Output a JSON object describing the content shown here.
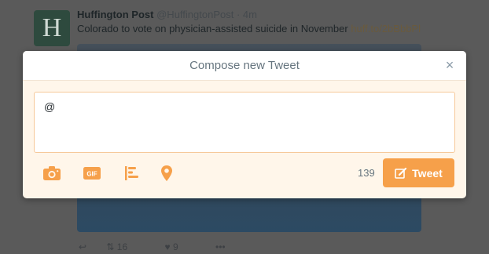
{
  "background_tweet": {
    "avatar_letter": "H",
    "author_name": "Huffington Post",
    "author_handle": "@HuffingtonPost",
    "time": "· 4m",
    "text": "Colorado to vote on physician-assisted suicide in November",
    "link": "huff.to/2bBbbPl",
    "actions": {
      "reply": "",
      "retweet_count": "16",
      "like_count": "9",
      "more": "•••"
    }
  },
  "modal": {
    "title": "Compose new Tweet",
    "close_icon": "close-icon",
    "tweet_text": "@",
    "char_count": "139",
    "tweet_button_label": "Tweet",
    "toolbar": [
      "camera-icon",
      "gif-icon",
      "poll-icon",
      "location-icon"
    ]
  },
  "colors": {
    "accent": "#f6a04a",
    "modal_bg": "#fff6ea",
    "input_border": "#f6c99a",
    "muted_text": "#66757f"
  }
}
